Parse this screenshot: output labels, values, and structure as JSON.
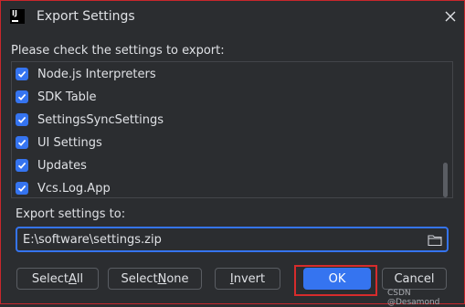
{
  "window": {
    "title": "Export Settings",
    "app_icon_text": "IJ",
    "close_icon": "close-icon"
  },
  "prompt": "Please check the settings to export:",
  "settings_list": [
    {
      "label": "Node.js Interpreters",
      "checked": true
    },
    {
      "label": "SDK Table",
      "checked": true
    },
    {
      "label": "SettingsSyncSettings",
      "checked": true
    },
    {
      "label": "UI Settings",
      "checked": true
    },
    {
      "label": "Updates",
      "checked": true
    },
    {
      "label": "Vcs.Log.App",
      "checked": true
    }
  ],
  "export_to": {
    "label": "Export settings to:",
    "value": "E:\\software\\settings.zip",
    "browse_icon": "folder-icon"
  },
  "buttons": {
    "select_all": {
      "prefix": "Select ",
      "mnemonic": "A",
      "suffix": "ll"
    },
    "select_none": {
      "prefix": "Select ",
      "mnemonic": "N",
      "suffix": "one"
    },
    "invert": {
      "prefix": "",
      "mnemonic": "I",
      "suffix": "nvert"
    },
    "ok": "OK",
    "cancel": "Cancel"
  },
  "watermark": "CSDN @Desamond",
  "colors": {
    "background": "#2b2d30",
    "accent": "#3574f0",
    "highlight_box": "#d62c2c",
    "text": "#dfe1e5"
  }
}
